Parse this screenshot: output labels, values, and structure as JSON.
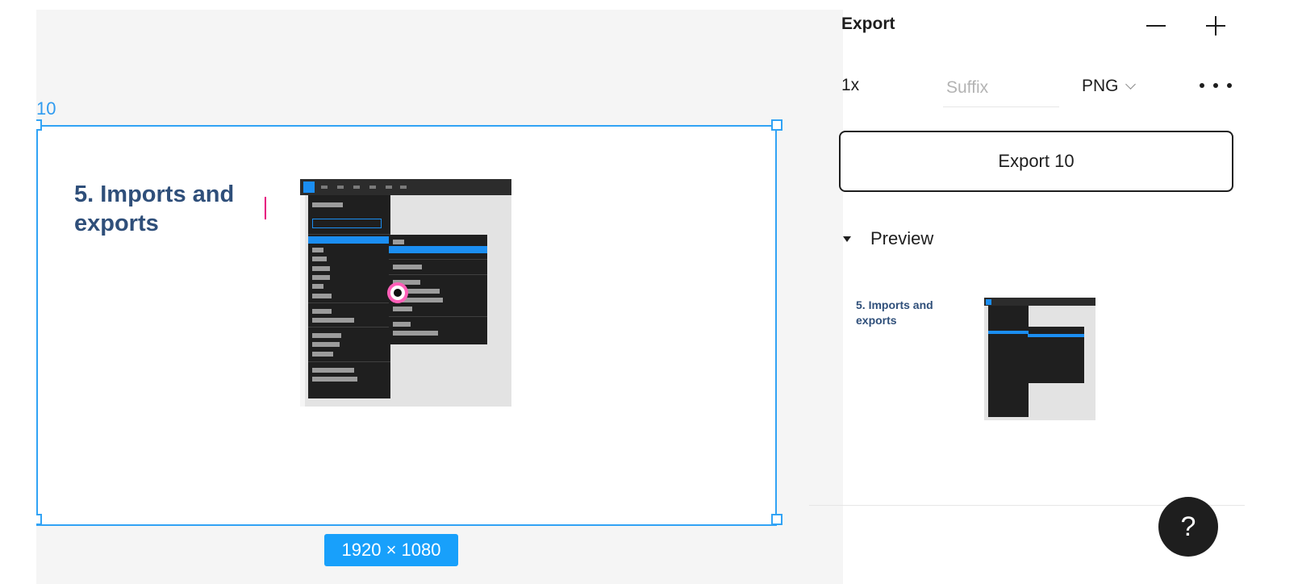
{
  "canvas": {
    "frame_name": "10",
    "frame_dimensions": "1920 × 1080",
    "slide": {
      "title": "5. Imports and\nexports"
    }
  },
  "export_panel": {
    "title": "Export",
    "remove_icon": "minus-icon",
    "add_icon": "plus-icon",
    "scale": "1x",
    "suffix_placeholder": "Suffix",
    "format": "PNG",
    "more_icon": "ellipsis-icon",
    "export_button_label": "Export 10",
    "preview_label": "Preview",
    "preview_title": "5. Imports and\nexports"
  },
  "help": {
    "label": "?"
  },
  "colors": {
    "selection": "#31a3f5",
    "dimension_badge": "#18a0fb",
    "slide_title": "#2f4f7a",
    "text_cursor": "#e6007e",
    "help_button": "#1e1e1e"
  }
}
